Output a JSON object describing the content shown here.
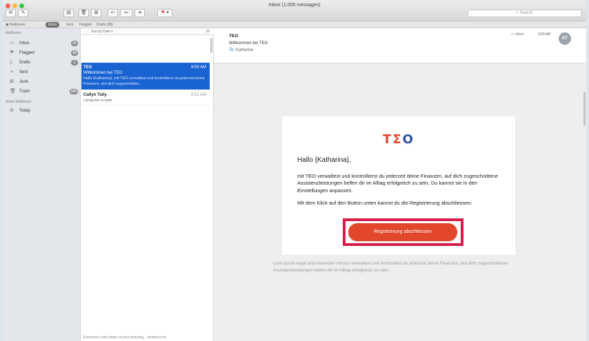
{
  "window": {
    "title": "Inbox (1,000 messages)",
    "search_placeholder": "Search"
  },
  "favorites": {
    "mailboxes": "Mailboxes",
    "inbox": "Inbox",
    "sent": "Sent",
    "flagged": "Flagged",
    "drafts": "Drafts (38)"
  },
  "sidebar": {
    "heading": "Mailboxes",
    "items": [
      {
        "label": "Inbox",
        "icon": "inbox-icon",
        "badge": "21"
      },
      {
        "label": "Flagged",
        "icon": "flag-icon",
        "badge": "18"
      },
      {
        "label": "Drafts",
        "icon": "draft-icon",
        "badge": "1"
      },
      {
        "label": "Sent",
        "icon": "sent-icon",
        "badge": ""
      },
      {
        "label": "Junk",
        "icon": "junk-icon",
        "badge": ""
      },
      {
        "label": "Trash",
        "icon": "trash-icon",
        "badge": "100"
      }
    ],
    "smart_heading": "Smart Mailboxes",
    "smart_items": [
      {
        "label": "Today",
        "icon": "gear-icon"
      }
    ]
  },
  "list": {
    "sort_label": "Sort by Date",
    "messages": [
      {
        "from": "TEO",
        "time": "9:00 AM",
        "subject": "Willkommen bei TEO",
        "preview": "Hallo {Katharina}, mit TEO verwaltest und kontrollierst du jederzeit deine Finanzen, auf dich zugeschnitten...",
        "selected": true
      },
      {
        "from": "Catlyn Tully",
        "time": "8:51 AM",
        "subject": "",
        "preview": "I propose a trade",
        "selected": false
      }
    ],
    "footer": "Everyone's well aware of your enduring... fondness for"
  },
  "message": {
    "from": "TEO",
    "subject": "Willkommen bei TEO",
    "to_label": "To:",
    "to_name": "Katharina",
    "folder": "Inbox",
    "time": "9:00 AM",
    "avatar": "DT"
  },
  "email": {
    "logo": "TEO",
    "greeting": "Hallo {Katharina},",
    "paragraph1": "mit TEO verwaltest und kontrollierst du jederzeit deine Finanzen, auf dich zugeschnittene Assistenzleistungen helfen dir im Alltag erfolgreich zu sein. Du kannst sie in den Einstellungen anpassen.",
    "paragraph2": "Mit dem Klick auf den Button unten kannst du die Registrierung abschliessen:",
    "button": "Registrierung abschliessen",
    "legal": "Lore ipsum legal und Absender mit teo verwaltest und kontrolliert du jederzeit deine Finanzen, auf dich zugeschnittene Assistenzleistungen helfen dir im Alltag erfolgreich zu sein."
  },
  "colors": {
    "accent_blue": "#1a63d2",
    "brand_red": "#e2472b",
    "brand_blue": "#2a4da3",
    "highlight": "#d81b4a"
  }
}
